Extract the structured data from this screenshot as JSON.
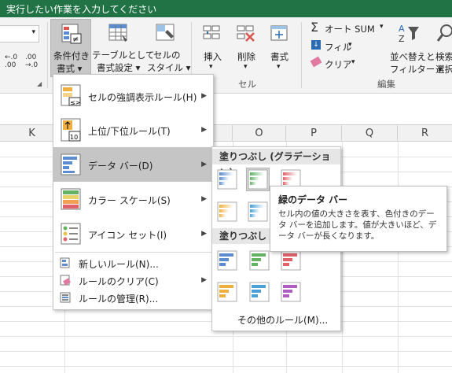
{
  "titlebar": {
    "search_hint": "実行したい作業を入力してください"
  },
  "ribbon": {
    "number_format": {
      "inc_decimal": "←.0 .00",
      "dec_decimal": ".00 →.0"
    },
    "styles": {
      "conditional_formatting": {
        "line1": "条件付き",
        "line2": "書式 ▾"
      },
      "format_as_table": {
        "line1": "テーブルとして",
        "line2": "書式設定 ▾"
      },
      "cell_styles": {
        "line1": "セルの",
        "line2": "スタイル ▾"
      }
    },
    "cells": {
      "insert": {
        "label": "挿入",
        "arrow": "▾"
      },
      "delete": {
        "label": "削除",
        "arrow": "▾"
      },
      "format": {
        "label": "書式",
        "arrow": "▾"
      },
      "group_label": "セル"
    },
    "editing": {
      "autosum": "オート SUM",
      "autosum_arrow": "▾",
      "fill": "フィル",
      "fill_arrow": "▾",
      "clear": "クリア",
      "clear_arrow": "▾",
      "sort_filter": {
        "line1": "並べ替えと",
        "line2": "フィルター ▾"
      },
      "find_select": {
        "line1": "検索",
        "line2": "選択"
      },
      "group_label": "編集"
    }
  },
  "columns": [
    "K",
    "O",
    "P",
    "Q",
    "R"
  ],
  "cf_menu": {
    "items": [
      {
        "label": "セルの強調表示ルール(H)"
      },
      {
        "label": "上位/下位ルール(T)"
      },
      {
        "label": "データ バー(D)"
      },
      {
        "label": "カラー スケール(S)"
      },
      {
        "label": "アイコン セット(I)"
      }
    ],
    "small_items": [
      {
        "label": "新しいルール(N)..."
      },
      {
        "label": "ルールのクリア(C)"
      },
      {
        "label": "ルールの管理(R)..."
      }
    ],
    "submenu_arrow": "▶"
  },
  "databar_submenu": {
    "gradient_header": "塗りつぶし (グラデーション)",
    "solid_header": "塗りつぶし (",
    "more_rules": "その他のルール(M)...",
    "colors": [
      "#5b8bd0",
      "#63b363",
      "#e0636b",
      "#f0b040",
      "#4aa0d8",
      "#b05fc0"
    ]
  },
  "tooltip": {
    "title": "緑のデータ バー",
    "description": "セル内の値の大きさを表す、色付きのデータ バーを追加します。値が大きいほど、データ バーが長くなります。"
  }
}
